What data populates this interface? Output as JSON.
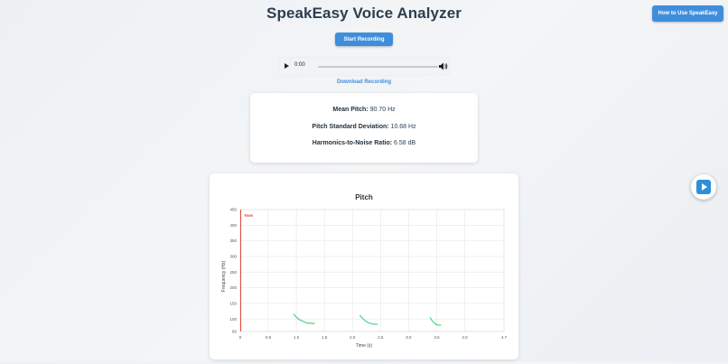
{
  "header": {
    "title": "SpeakEasy Voice Analyzer",
    "help_label": "How to Use SpeakEasy"
  },
  "controls": {
    "record_label": "Start Recording",
    "download_label": "Download Recording"
  },
  "player": {
    "time": "0:00"
  },
  "stats": {
    "mean_pitch_label": "Mean Pitch:",
    "mean_pitch_value": "90.70 Hz",
    "pitch_sd_label": "Pitch Standard Deviation:",
    "pitch_sd_value": "10.68 Hz",
    "hnr_label": "Harmonics-to-Noise Ratio:",
    "hnr_value": "6.58 dB"
  },
  "colors": {
    "accent": "#3f8edb",
    "line": "#2ecc71",
    "now_marker": "#e74c3c"
  },
  "chart_data": {
    "type": "line",
    "title": "Pitch",
    "xlabel": "Time (s)",
    "ylabel": "Frequency (Hz)",
    "xlim": [
      0,
      4.7
    ],
    "ylim": [
      60,
      450
    ],
    "x_ticks": [
      "0",
      "0.5",
      "1.0",
      "1.5",
      "2.0",
      "2.5",
      "3.0",
      "3.5",
      "4.0",
      "4.7"
    ],
    "x_tick_values": [
      0,
      0.5,
      1.0,
      1.5,
      2.0,
      2.5,
      3.0,
      3.5,
      4.0,
      4.7
    ],
    "y_ticks": [
      "60",
      "100",
      "150",
      "200",
      "250",
      "300",
      "350",
      "400",
      "450"
    ],
    "y_tick_values": [
      60,
      100,
      150,
      200,
      250,
      300,
      350,
      400,
      450
    ],
    "grid": true,
    "now_marker": {
      "label": "Now",
      "x": 0
    },
    "series": [
      {
        "segments": [
          {
            "x": [
              0.95,
              1.0,
              1.05,
              1.1,
              1.15,
              1.2,
              1.25,
              1.3,
              1.33
            ],
            "y": [
              116,
              106,
              98,
              94,
              90,
              86,
              87,
              85,
              87
            ]
          },
          {
            "x": [
              2.13,
              2.18,
              2.23,
              2.28,
              2.33,
              2.38,
              2.45
            ],
            "y": [
              112,
              102,
              94,
              88,
              85,
              83,
              83
            ]
          },
          {
            "x": [
              3.38,
              3.42,
              3.46,
              3.5,
              3.54,
              3.58
            ],
            "y": [
              105,
              94,
              87,
              82,
              80,
              81
            ]
          }
        ]
      }
    ]
  }
}
